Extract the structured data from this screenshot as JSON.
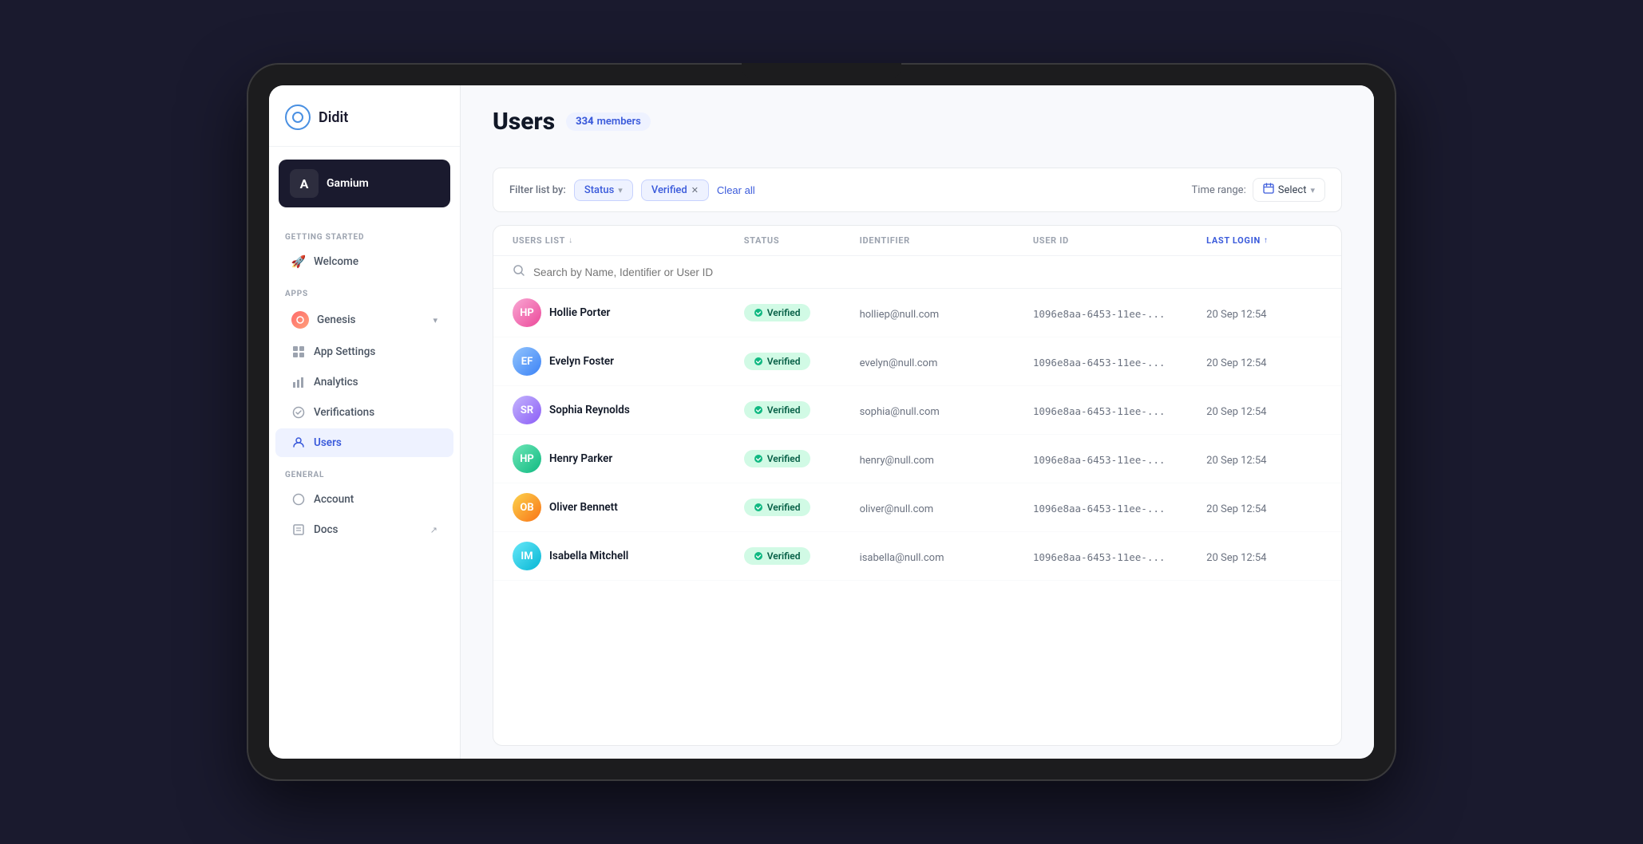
{
  "app": {
    "name": "Didit"
  },
  "workspace": {
    "name": "Gamium",
    "icon": "A"
  },
  "sidebar": {
    "sections": [
      {
        "label": "GETTING STARTED",
        "items": [
          {
            "id": "welcome",
            "label": "Welcome",
            "icon": "🚀",
            "active": false
          }
        ]
      },
      {
        "label": "APPS",
        "appSelector": {
          "name": "Genesis",
          "icon": "●"
        },
        "items": [
          {
            "id": "app-settings",
            "label": "App Settings",
            "icon": "⊞",
            "active": false
          },
          {
            "id": "analytics",
            "label": "Analytics",
            "icon": "📊",
            "active": false
          },
          {
            "id": "verifications",
            "label": "Verifications",
            "icon": "⚙",
            "active": false
          },
          {
            "id": "users",
            "label": "Users",
            "icon": "👤",
            "active": true
          }
        ]
      },
      {
        "label": "GENERAL",
        "items": [
          {
            "id": "account",
            "label": "Account",
            "icon": "○",
            "active": false
          },
          {
            "id": "docs",
            "label": "Docs",
            "icon": "≡",
            "active": false
          }
        ]
      }
    ]
  },
  "page": {
    "title": "Users",
    "badge": {
      "count": "334",
      "label": "members"
    }
  },
  "filters": {
    "label": "Filter list by:",
    "chips": [
      {
        "id": "status",
        "label": "Status",
        "removable": false
      },
      {
        "id": "verified",
        "label": "Verified",
        "removable": true
      }
    ],
    "clearAll": "Clear all",
    "timeRange": {
      "label": "Time range:",
      "selectLabel": "Select"
    }
  },
  "table": {
    "columns": [
      {
        "id": "users-list",
        "label": "USERS LIST",
        "sortable": true,
        "active": false
      },
      {
        "id": "status",
        "label": "STATUS",
        "sortable": false,
        "active": false
      },
      {
        "id": "identifier",
        "label": "IDENTIFIER",
        "sortable": false,
        "active": false
      },
      {
        "id": "user-id",
        "label": "USER ID",
        "sortable": false,
        "active": false
      },
      {
        "id": "last-login",
        "label": "LAST LOGIN",
        "sortable": true,
        "active": true
      }
    ],
    "search": {
      "placeholder": "Search by Name, Identifier or User ID"
    },
    "rows": [
      {
        "id": 1,
        "name": "Hollie Porter",
        "status": "Verified",
        "identifier": "holliep@null.com",
        "userId": "1096e8aa-6453-11ee-...",
        "lastLogin": "20 Sep 12:54",
        "avatarColor": "av-pink"
      },
      {
        "id": 2,
        "name": "Evelyn Foster",
        "status": "Verified",
        "identifier": "evelyn@null.com",
        "userId": "1096e8aa-6453-11ee-...",
        "lastLogin": "20 Sep 12:54",
        "avatarColor": "av-blue"
      },
      {
        "id": 3,
        "name": "Sophia Reynolds",
        "status": "Verified",
        "identifier": "sophia@null.com",
        "userId": "1096e8aa-6453-11ee-...",
        "lastLogin": "20 Sep 12:54",
        "avatarColor": "av-purple"
      },
      {
        "id": 4,
        "name": "Henry Parker",
        "status": "Verified",
        "identifier": "henry@null.com",
        "userId": "1096e8aa-6453-11ee-...",
        "lastLogin": "20 Sep 12:54",
        "avatarColor": "av-green"
      },
      {
        "id": 5,
        "name": "Oliver Bennett",
        "status": "Verified",
        "identifier": "oliver@null.com",
        "userId": "1096e8aa-6453-11ee-...",
        "lastLogin": "20 Sep 12:54",
        "avatarColor": "av-orange"
      },
      {
        "id": 6,
        "name": "Isabella Mitchell",
        "status": "Verified",
        "identifier": "isabella@null.com",
        "userId": "1096e8aa-6453-11ee-...",
        "lastLogin": "20 Sep 12:54",
        "avatarColor": "av-teal"
      }
    ]
  }
}
